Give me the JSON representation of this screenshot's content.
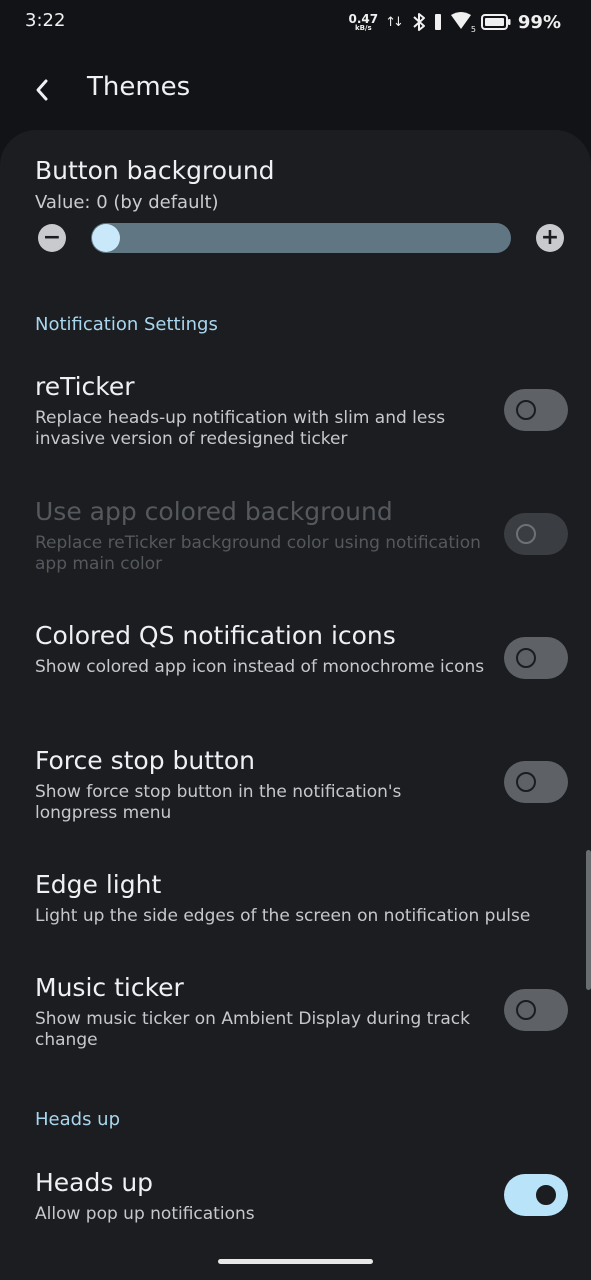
{
  "status_bar": {
    "time": "3:22",
    "net_speed_value": "0.47",
    "net_speed_unit": "kB/s",
    "signal_badge": "5",
    "battery_percent": "99%"
  },
  "app_bar": {
    "title": "Themes"
  },
  "slider": {
    "title": "Button background",
    "value_text": "Value: 0 (by default)",
    "value": 0,
    "minus_label": "−",
    "plus_label": "+"
  },
  "sections": {
    "notification_settings": "Notification Settings",
    "heads_up": "Heads up"
  },
  "settings": [
    {
      "title": "reTicker",
      "desc": "Replace heads-up notification with slim and less invasive version of redesigned ticker",
      "checked": false,
      "enabled": true
    },
    {
      "title": "Use app colored background",
      "desc": "Replace reTicker background color using notification app main color",
      "checked": false,
      "enabled": false
    },
    {
      "title": "Colored QS notification icons",
      "desc": "Show colored app icon instead of monochrome icons",
      "checked": false,
      "enabled": true
    },
    {
      "title": "Force stop button",
      "desc": "Show force stop button in the notification's longpress menu",
      "checked": false,
      "enabled": true
    },
    {
      "title": "Edge light",
      "desc": "Light up the side edges of the screen on notification pulse",
      "enabled": true
    },
    {
      "title": "Music ticker",
      "desc": "Show music ticker on Ambient Display during track change",
      "checked": false,
      "enabled": true
    },
    {
      "title": "Heads up",
      "desc": "Allow pop up notifications",
      "checked": true,
      "enabled": true
    }
  ],
  "colors": {
    "background": "#111316",
    "panel": "#1b1d20",
    "accent": "#a9d6ef",
    "toggle_on": "#b9e3f9",
    "toggle_off": "#5e6166"
  },
  "icons": {
    "back": "chevron-left-icon",
    "bluetooth": "bluetooth-icon",
    "signal": "cell-signal-icon",
    "wifi": "wifi-icon",
    "battery": "battery-icon"
  }
}
